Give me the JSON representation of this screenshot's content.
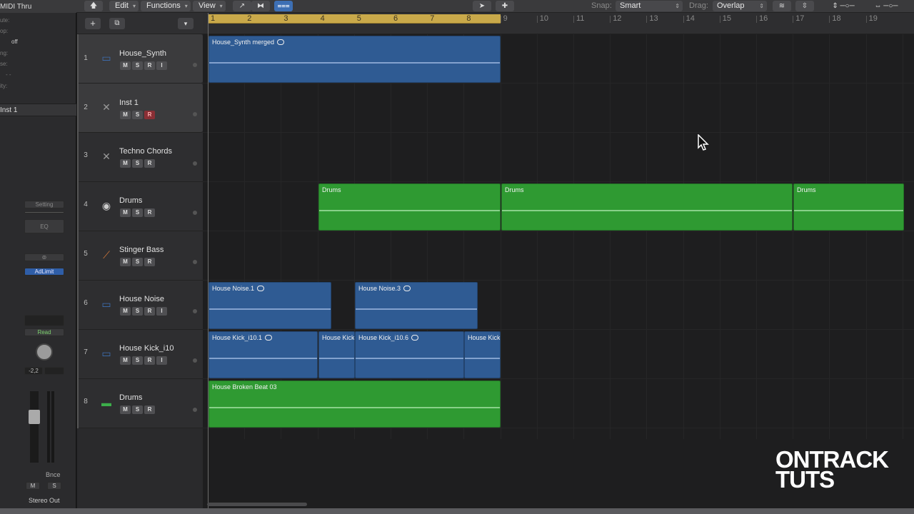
{
  "toolbar": {
    "menus": [
      "Edit",
      "Functions",
      "View"
    ],
    "snap_label": "Snap:",
    "snap_value": "Smart",
    "drag_label": "Drag:",
    "drag_value": "Overlap"
  },
  "inspector": {
    "midi_thru": "MIDI Thru",
    "rows": [
      "ute:",
      "op:",
      "off",
      "ng:",
      "se:",
      "- -",
      "ity:"
    ],
    "inst_label": "Inst 1",
    "setting": "Setting",
    "eq": "EQ",
    "adlimit": "AdLimit",
    "read": "Read",
    "pan_value": "-2,2",
    "bnce": "Bnce",
    "mute": "M",
    "solo": "S",
    "output": "Stereo Out"
  },
  "tracks": [
    {
      "num": "1",
      "name": "House_Synth",
      "buttons": [
        "M",
        "S",
        "R",
        "I"
      ],
      "icon": "synth-icon"
    },
    {
      "num": "2",
      "name": "Inst 1",
      "buttons": [
        "M",
        "S",
        "R"
      ],
      "icon": "instrument-icon"
    },
    {
      "num": "3",
      "name": "Techno Chords",
      "buttons": [
        "M",
        "S",
        "R"
      ],
      "icon": "instrument-icon"
    },
    {
      "num": "4",
      "name": "Drums",
      "buttons": [
        "M",
        "S",
        "R"
      ],
      "icon": "drums-icon"
    },
    {
      "num": "5",
      "name": "Stinger Bass",
      "buttons": [
        "M",
        "S",
        "R"
      ],
      "icon": "bass-icon"
    },
    {
      "num": "6",
      "name": "House Noise",
      "buttons": [
        "M",
        "S",
        "R",
        "I"
      ],
      "icon": "synth-icon"
    },
    {
      "num": "7",
      "name": "House Kick_i10",
      "buttons": [
        "M",
        "S",
        "R",
        "I"
      ],
      "icon": "synth-icon"
    },
    {
      "num": "8",
      "name": "Drums",
      "buttons": [
        "M",
        "S",
        "R"
      ],
      "icon": "drum-machine-icon"
    }
  ],
  "ruler": [
    "1",
    "2",
    "3",
    "4",
    "5",
    "6",
    "7",
    "8",
    "9",
    "10",
    "11",
    "12",
    "13",
    "14",
    "15",
    "16",
    "17",
    "18",
    "19"
  ],
  "regions": {
    "r1": "House_Synth merged",
    "r4a": "Drums",
    "r4b": "Drums",
    "r4c": "Drums",
    "r6a": "House Noise.1",
    "r6b": "House Noise.3",
    "r7a": "House Kick_i10.1",
    "r7b": "House Kick",
    "r7c": "House Kick_i10.6",
    "r7d": "House Kick",
    "r8": "House Broken Beat 03"
  },
  "logo": {
    "line1": "ONTRACK",
    "line2": "TUTS"
  },
  "colors": {
    "audio_region": "#2f5b93",
    "drummer_region": "#2f9a32",
    "cycle": "#c9a94a"
  }
}
